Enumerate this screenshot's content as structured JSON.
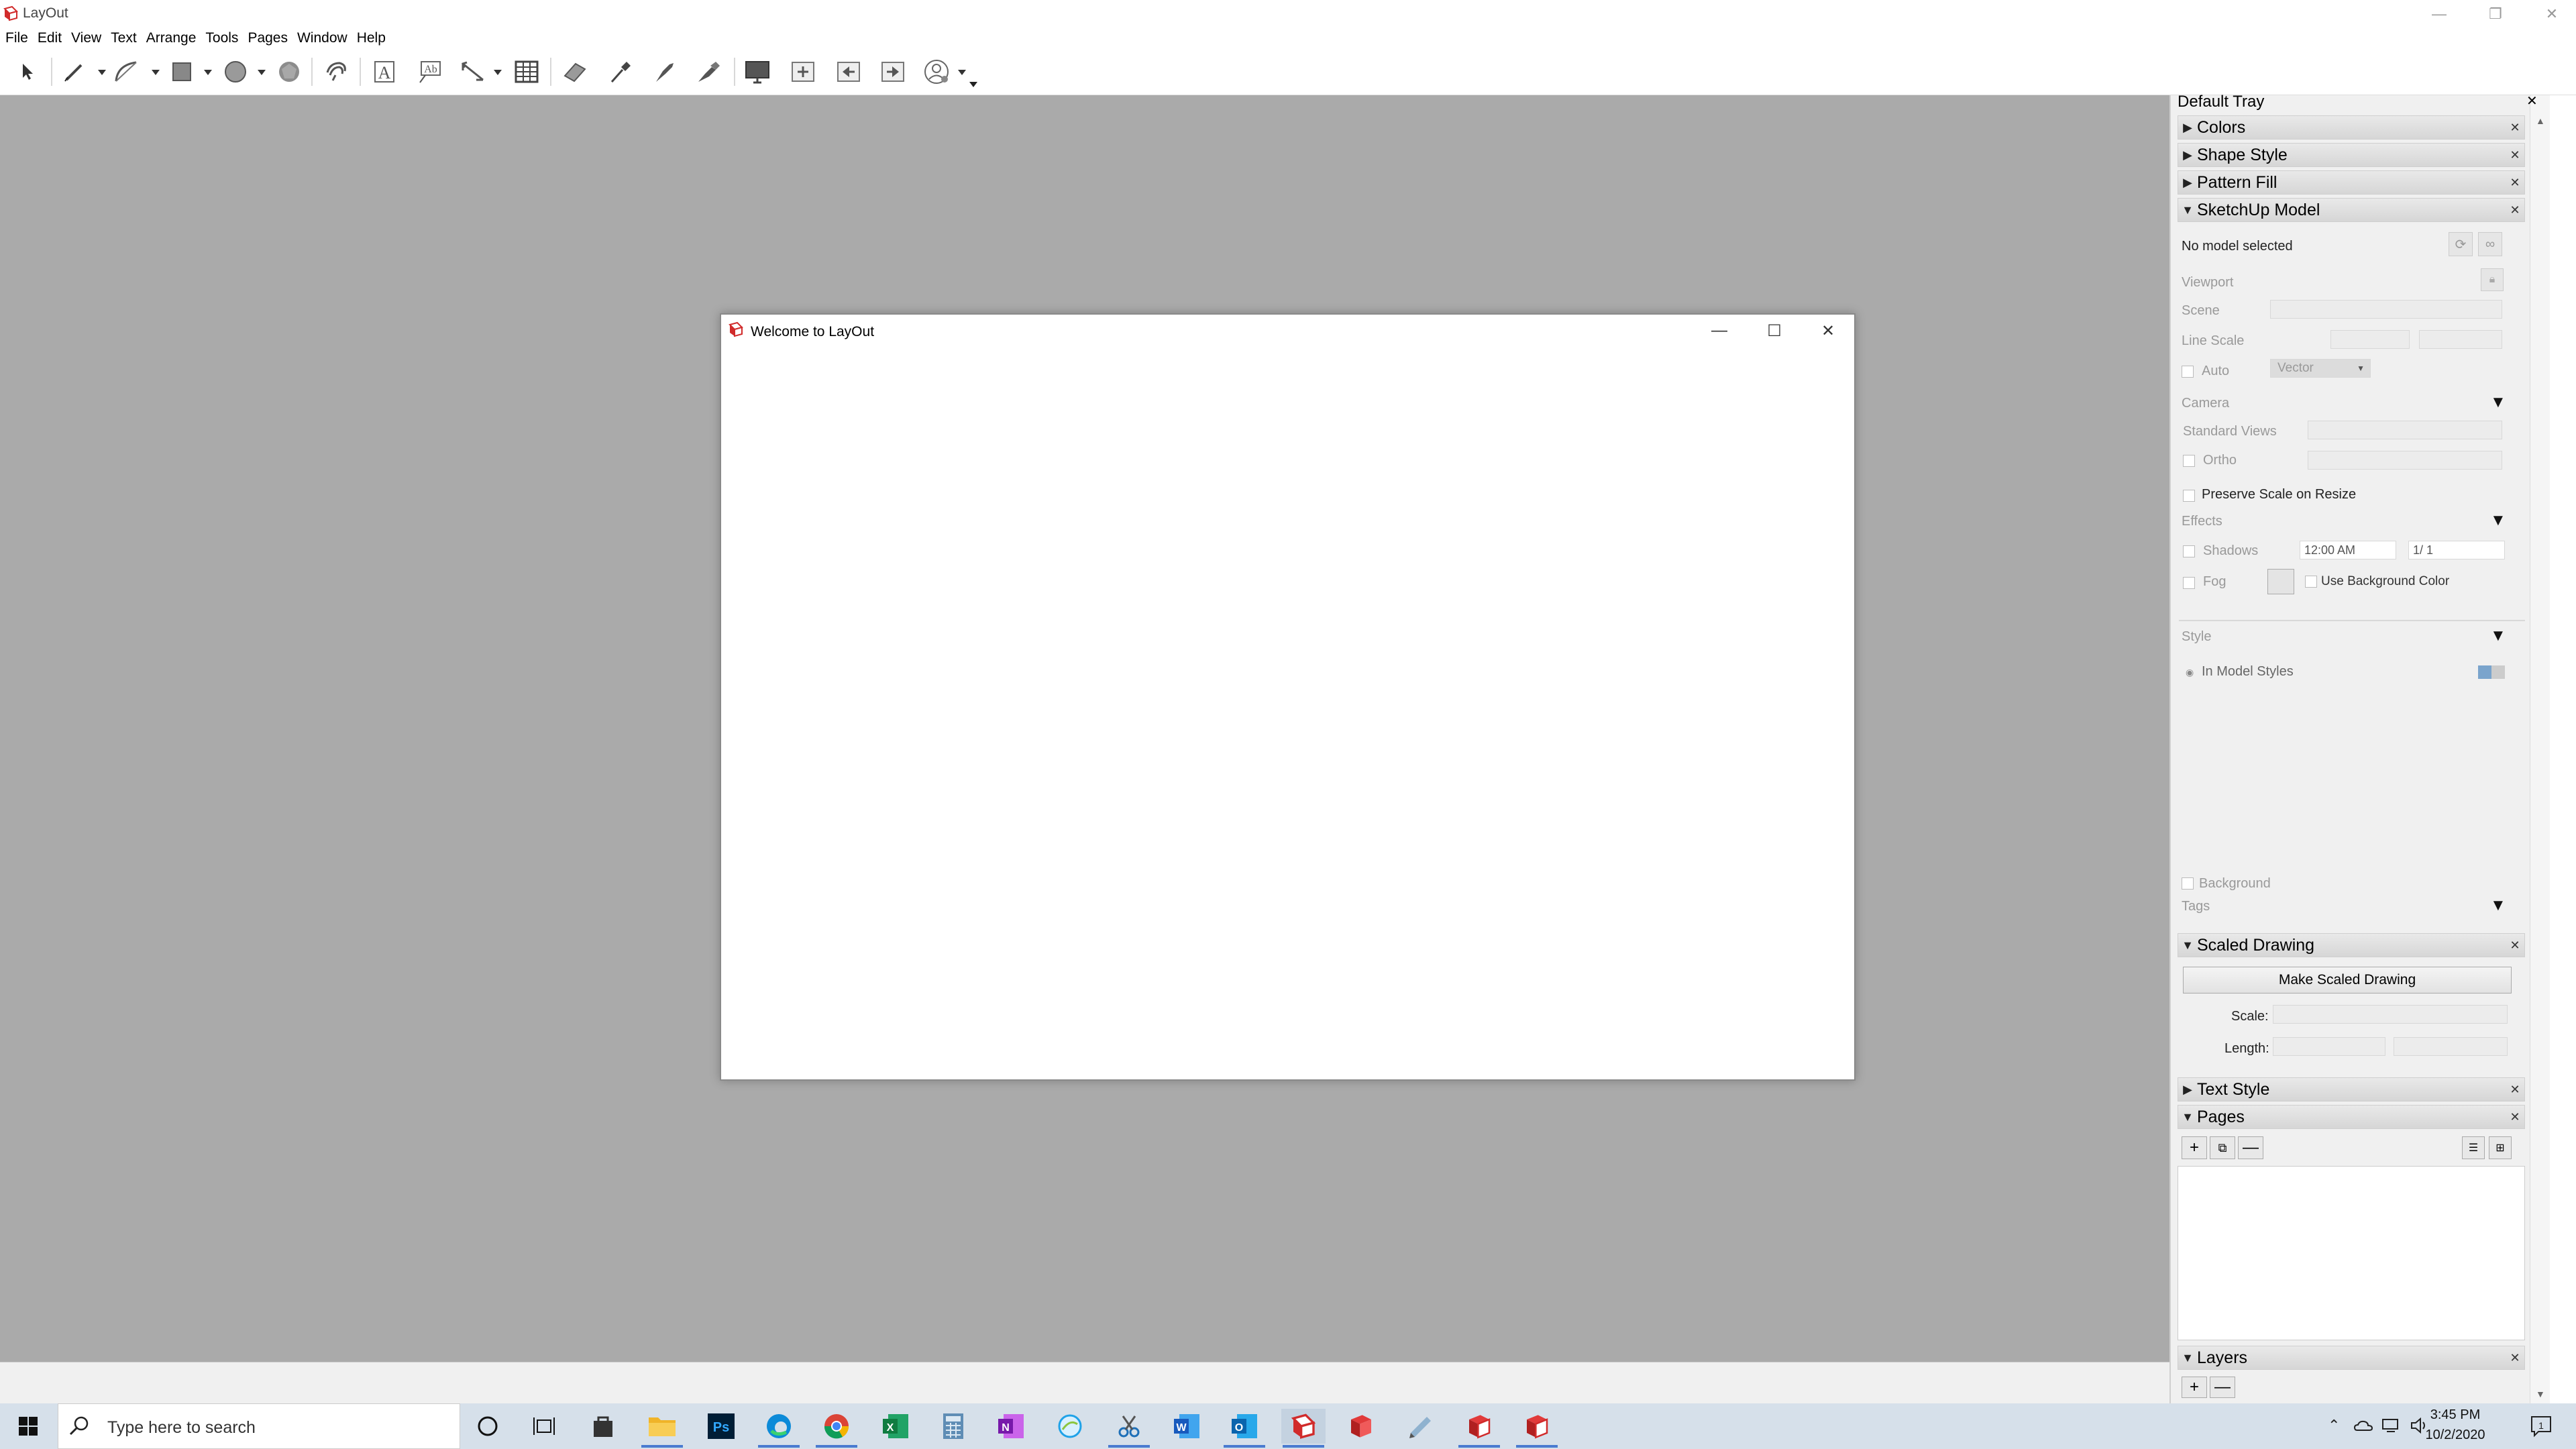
{
  "window": {
    "title": "LayOut",
    "brand_color": "#d12b2b"
  },
  "menu": [
    "File",
    "Edit",
    "View",
    "Text",
    "Arrange",
    "Tools",
    "Pages",
    "Window",
    "Help"
  ],
  "toolbar": {
    "icons": [
      "select-tool",
      "line-tool",
      "arc-tool",
      "rectangle-tool",
      "circle-tool",
      "polygon-tool",
      "offset-tool",
      "text-tool",
      "label-tool",
      "dimension-tool",
      "table-tool",
      "eraser-tool",
      "style-tool",
      "split-tool",
      "join-tool",
      "presentation",
      "add-page",
      "previous-page",
      "next-page",
      "user-account"
    ]
  },
  "dialog": {
    "title": "Welcome to LayOut"
  },
  "tray": {
    "title": "Default Tray",
    "panels": {
      "colors": "Colors",
      "shape_style": "Shape Style",
      "pattern_fill": "Pattern Fill",
      "sketchup_model": "SketchUp Model",
      "scaled_drawing": "Scaled Drawing",
      "text_style": "Text Style",
      "pages": "Pages",
      "layers": "Layers"
    },
    "model": {
      "no_model": "No model selected",
      "viewport": "Viewport",
      "scene": "Scene",
      "line_scale": "Line Scale",
      "auto": "Auto",
      "render_mode": "Vector",
      "camera": "Camera",
      "standard_views": "Standard Views",
      "ortho": "Ortho",
      "preserve_scale": "Preserve Scale on Resize",
      "effects": "Effects",
      "shadows": "Shadows",
      "shadow_time": "12:00 AM",
      "shadow_date": "1/ 1",
      "fog": "Fog",
      "use_bg_color": "Use Background Color",
      "style": "Style",
      "in_model_styles": "In Model Styles",
      "background": "Background",
      "tags": "Tags"
    },
    "scaled": {
      "button": "Make Scaled Drawing",
      "scale": "Scale:",
      "length": "Length:"
    }
  },
  "taskbar": {
    "search_placeholder": "Type here to search",
    "time": "3:45 PM",
    "date": "10/2/2020",
    "apps": [
      "task-view",
      "store",
      "file-explorer",
      "photoshop",
      "edge",
      "chrome",
      "excel",
      "calculator",
      "onenote",
      "app-bubble",
      "snipping",
      "word",
      "outlook",
      "layout",
      "sketchup",
      "style-builder",
      "sketchup-2",
      "sketchup-3"
    ]
  }
}
